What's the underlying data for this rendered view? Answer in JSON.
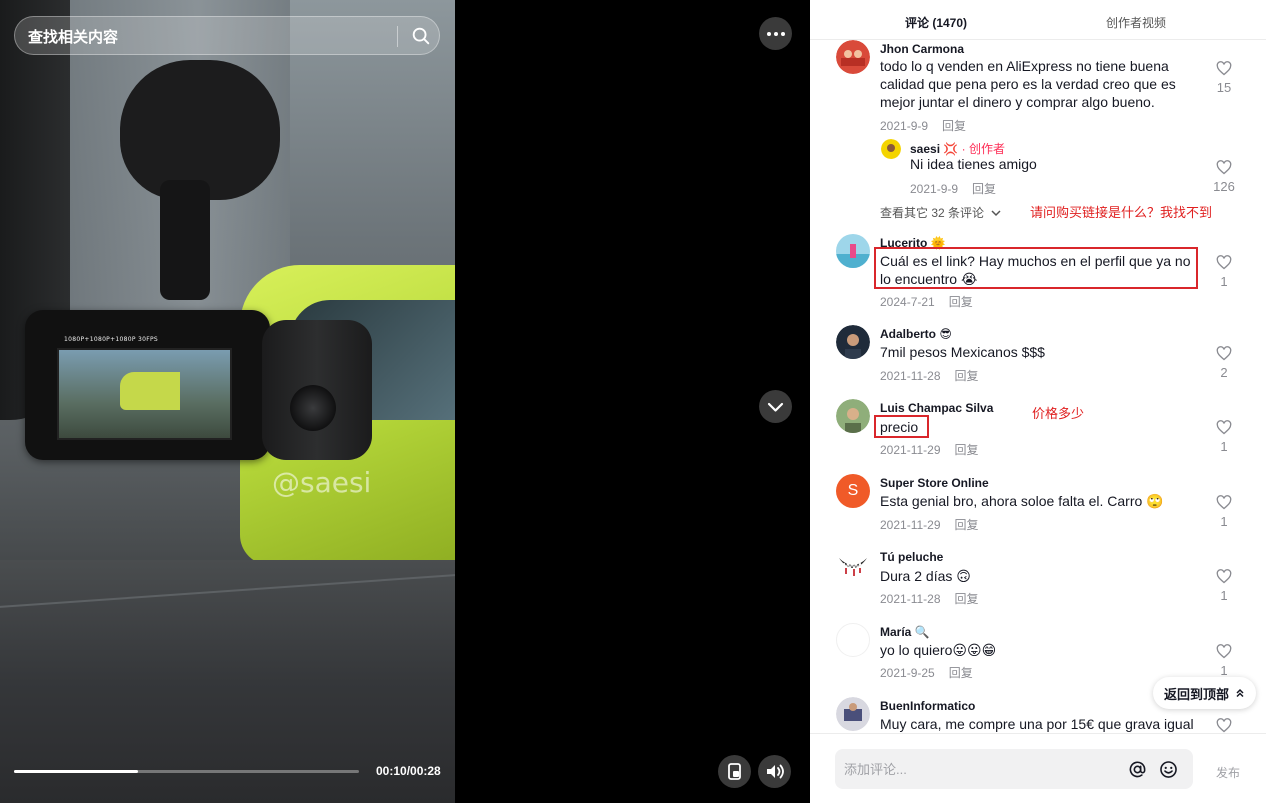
{
  "search": {
    "placeholder": "查找相关内容"
  },
  "video": {
    "watermark": "@saesi",
    "cam_overlay_text": "1080P+1080P+1080P  30FPS",
    "time": "00:10/00:28",
    "progress_fraction": 0.36
  },
  "tabs": [
    {
      "label": "评论 (1470)",
      "active": true
    },
    {
      "label": "创作者视频",
      "active": false
    }
  ],
  "comments": [
    {
      "name": "Jhon Carmona",
      "text": "todo lo q venden en AliExpress no tiene buena calidad que pena pero es la verdad creo que es mejor juntar el dinero y comprar algo bueno.",
      "date": "2021-9-9",
      "reply": "回复",
      "likes": "15",
      "avatar_color": "#c0392b"
    },
    {
      "name": "saesi 💢",
      "author_tag": " · 创作者",
      "text": "Ni idea tienes amigo",
      "date": "2021-9-9",
      "reply": "回复",
      "likes": "126",
      "avatar_color": "#f4d400"
    },
    {
      "name": "Lucerito 🌞",
      "text": "Cuál es el link? Hay muchos en el perfil que ya no lo encuentro 😭",
      "date": "2024-7-21",
      "reply": "回复",
      "likes": "1",
      "avatar_color": "#7ac5e0"
    },
    {
      "name": "Adalberto 😎",
      "text": "7mil pesos Mexicanos $$$",
      "date": "2021-11-28",
      "reply": "回复",
      "likes": "2",
      "avatar_color": "#1f2b3a"
    },
    {
      "name": "Luis Champac Silva",
      "text": "precio",
      "date": "2021-11-29",
      "reply": "回复",
      "likes": "1",
      "avatar_color": "#6b8f5a"
    },
    {
      "name": "Super Store Online",
      "text": "Esta genial bro, ahora soloe falta el. Carro 🙄",
      "date": "2021-11-29",
      "reply": "回复",
      "likes": "1",
      "avatar_color": "#f05a28",
      "avatar_letter": "S"
    },
    {
      "name": "Tú peluche",
      "text": "Dura 2 días 🙃",
      "date": "2021-11-28",
      "reply": "回复",
      "likes": "1",
      "avatar_color": "#ffffff"
    },
    {
      "name": "María 🔍",
      "text": "yo lo quiero😛😛😁",
      "date": "2021-9-25",
      "reply": "回复",
      "likes": "1",
      "avatar_color": "#ffffff"
    },
    {
      "name": "BuenInformatico",
      "text": "Muy cara, me compre una por 15€ que grava igual",
      "avatar_color": "#4a4f7a"
    }
  ],
  "view_more": "查看其它 32 条评论",
  "annotations": {
    "link_question": "请问购买链接是什么？我找不到",
    "price_question": "价格多少"
  },
  "back_to_top": "返回到顶部",
  "comment_box": {
    "placeholder": "添加评论...",
    "send": "发布"
  }
}
